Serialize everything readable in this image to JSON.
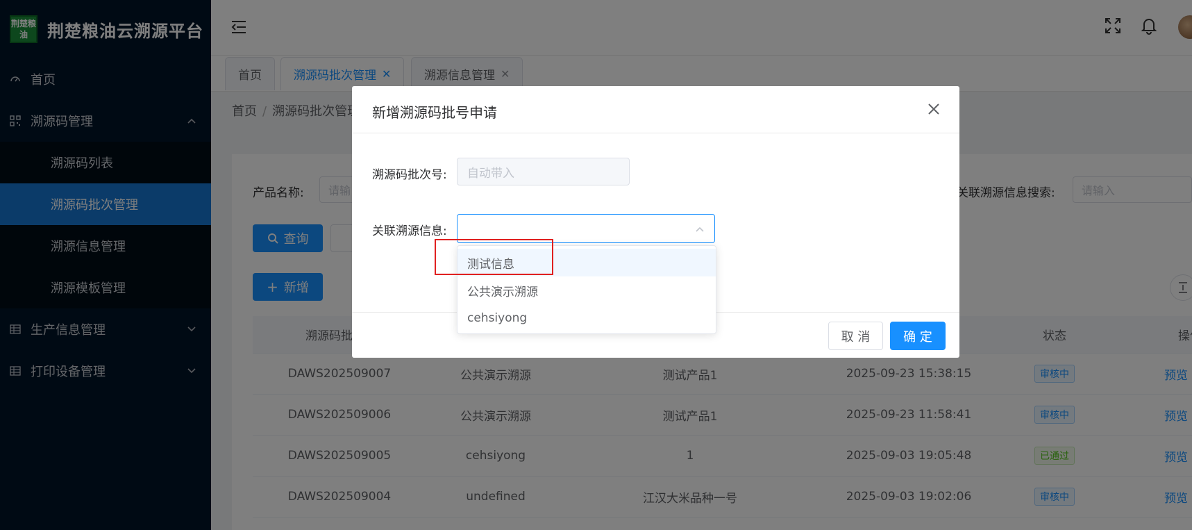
{
  "app": {
    "title": "荆楚粮油云溯源平台",
    "logo_text": "荆楚粮油"
  },
  "sidebar": {
    "items": [
      {
        "label": "首页",
        "icon": "dashboard-icon"
      },
      {
        "label": "溯源码管理",
        "icon": "qrcode-icon",
        "expanded": true,
        "children": [
          "溯源码列表",
          "溯源码批次管理",
          "溯源信息管理",
          "溯源模板管理"
        ],
        "active_child": "溯源码批次管理"
      },
      {
        "label": "生产信息管理",
        "icon": "table-icon"
      },
      {
        "label": "打印设备管理",
        "icon": "table-icon"
      }
    ]
  },
  "tabs": [
    {
      "label": "首页",
      "closable": false
    },
    {
      "label": "溯源码批次管理",
      "closable": true,
      "active": true
    },
    {
      "label": "溯源信息管理",
      "closable": true
    }
  ],
  "breadcrumb": [
    "首页",
    "溯源码批次管理"
  ],
  "filters": {
    "product_label": "产品名称:",
    "product_placeholder": "请输",
    "related_label": "关联溯源信息搜索:",
    "related_placeholder": "请输入",
    "query_button": "查询",
    "add_button": "新增"
  },
  "table": {
    "headers": [
      "溯源码批",
      "状态",
      "操作"
    ],
    "rows": [
      {
        "batch": "DAWS202509007",
        "source": "公共演示溯源",
        "product": "测试产品1",
        "time": "2025-09-23 15:38:15",
        "status": "审核中",
        "status_type": "review",
        "action": "预览"
      },
      {
        "batch": "DAWS202509006",
        "source": "公共演示溯源",
        "product": "测试产品1",
        "time": "2025-09-23 11:58:41",
        "status": "审核中",
        "status_type": "review",
        "action": "预览"
      },
      {
        "batch": "DAWS202509005",
        "source": "cehsiyong",
        "product": "1",
        "time": "2025-09-03 19:05:48",
        "status": "已通过",
        "status_type": "pass",
        "action": "预览"
      },
      {
        "batch": "DAWS202509004",
        "source": "undefined",
        "product": "江汉大米品种一号",
        "time": "2025-09-03 19:02:06",
        "status": "审核中",
        "status_type": "review",
        "action": "预览"
      }
    ]
  },
  "modal": {
    "title": "新增溯源码批号申请",
    "batch_label": "溯源码批次号:",
    "batch_placeholder": "自动带入",
    "related_label": "关联溯源信息:",
    "related_value": "",
    "cancel": "取 消",
    "confirm": "确 定",
    "options": [
      "测试信息",
      "公共演示溯源",
      "cehsiyong"
    ],
    "hovered_option": "测试信息"
  },
  "colors": {
    "primary": "#1890ff",
    "sidebar_bg": "#001529",
    "active_menu": "#1677d2",
    "highlight": "#e02020"
  }
}
